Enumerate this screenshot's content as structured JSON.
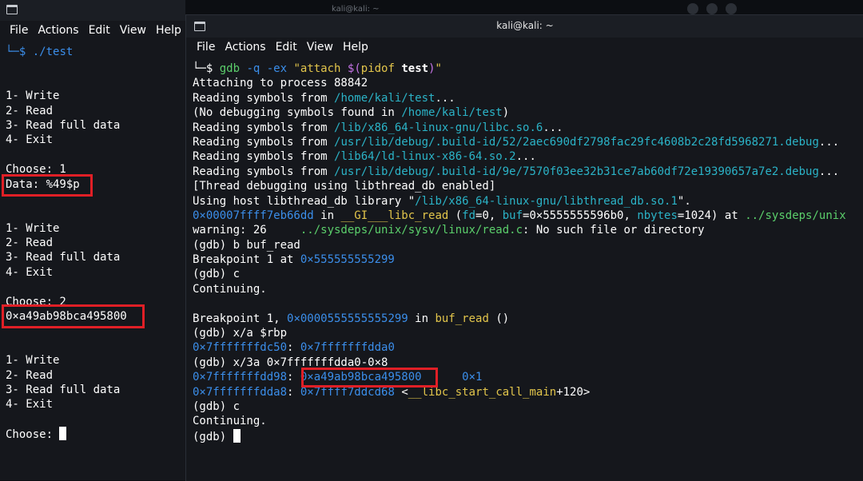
{
  "background_window": {
    "title": "kali@kali: ~"
  },
  "left_terminal": {
    "menu": [
      "File",
      "Actions",
      "Edit",
      "View",
      "Help"
    ],
    "lines": {
      "l0": {
        "prompt": "└─$",
        "cmd": " ./test"
      },
      "l3": "1- Write",
      "l4": "2- Read",
      "l5": "3- Read full data",
      "l6": "4- Exit",
      "l8": "Choose: 1",
      "l9": "Data: %49$p",
      "l12": "1- Write",
      "l13": "2- Read",
      "l14": "3- Read full data",
      "l15": "4- Exit",
      "l17": "Choose: 2",
      "l18": "0×a49ab98bca495800",
      "l21": "1- Write",
      "l22": "2- Read",
      "l23": "3- Read full data",
      "l24": "4- Exit",
      "l26": "Choose: "
    }
  },
  "right_terminal": {
    "title": "kali@kali: ~",
    "menu": [
      "File",
      "Actions",
      "Edit",
      "View",
      "Help"
    ],
    "cmd": {
      "prompt": "└─$",
      "gdb": "gdb",
      "args": " -q -ex ",
      "q1": "\"attach ",
      "subst": "$(",
      "pidof": "pidof",
      "sp": " ",
      "test": "test",
      "close": ")",
      "q2": "\""
    },
    "lines": {
      "r1": "Attaching to process 88842",
      "r2a": "Reading symbols from ",
      "r2b": "/home/kali/test",
      "r2c": "...",
      "r3a": "(No debugging symbols found in ",
      "r3b": "/home/kali/test",
      "r3c": ")",
      "r4a": "Reading symbols from ",
      "r4b": "/lib/x86_64-linux-gnu/libc.so.6",
      "r4c": "...",
      "r5a": "Reading symbols from ",
      "r5b": "/usr/lib/debug/.build-id/52/2aec690df2798fac29fc4608b2c28fd5968271.debug",
      "r5c": "...",
      "r6a": "Reading symbols from ",
      "r6b": "/lib64/ld-linux-x86-64.so.2",
      "r6c": "...",
      "r7a": "Reading symbols from ",
      "r7b": "/usr/lib/debug/.build-id/9e/7570f03ee32b31ce7ab60df72e19390657a7e2.debug",
      "r7c": "...",
      "r8": "[Thread debugging using libthread_db enabled]",
      "r9a": "Using host libthread_db library \"",
      "r9b": "/lib/x86_64-linux-gnu/libthread_db.so.1",
      "r9c": "\".",
      "r10a": "0×00007ffff7eb66dd",
      "r10b": " in ",
      "r10c": "__GI___libc_read",
      "r10d": " (",
      "r10e": "fd",
      "r10f": "=0, ",
      "r10g": "buf",
      "r10h": "=0×5555555596b0, ",
      "r10i": "nbytes",
      "r10j": "=1024) at ",
      "r10k": "../sysdeps/unix",
      "r11a": "warning: 26     ",
      "r11b": "../sysdeps/unix/sysv/linux/read.c",
      "r11c": ": No such file or directory",
      "r12": "(gdb) b buf_read",
      "r13a": "Breakpoint 1 at ",
      "r13b": "0×555555555299",
      "r14": "(gdb) c",
      "r15": "Continuing.",
      "r17a": "Breakpoint 1, ",
      "r17b": "0×0000555555555299",
      "r17c": " in ",
      "r17d": "buf_read",
      "r17e": " ()",
      "r18": "(gdb) x/a $rbp",
      "r19a": "0×7fffffffdc50",
      "r19b": ": ",
      "r19c": "0×7fffffffdda0",
      "r20": "(gdb) x/3a 0×7fffffffdda0-0×8",
      "r21a": "0×7fffffffdd98",
      "r21b": ": ",
      "r21c": "0×a49ab98bca495800",
      "r21d": "      ",
      "r21e": "0×1",
      "r22a": "0×7fffffffdda8",
      "r22b": ": ",
      "r22c": "0×7ffff7ddcd68",
      "r22d": " <",
      "r22e": "__libc_start_call_main",
      "r22f": "+120>",
      "r23": "(gdb) c",
      "r24": "Continuing.",
      "r25": "(gdb) "
    }
  },
  "colors": {
    "highlight_box": "#e01f26",
    "path_cyan": "#2bb3c7",
    "addr_blue": "#3b8eea",
    "func_yellow": "#e2c54b"
  }
}
